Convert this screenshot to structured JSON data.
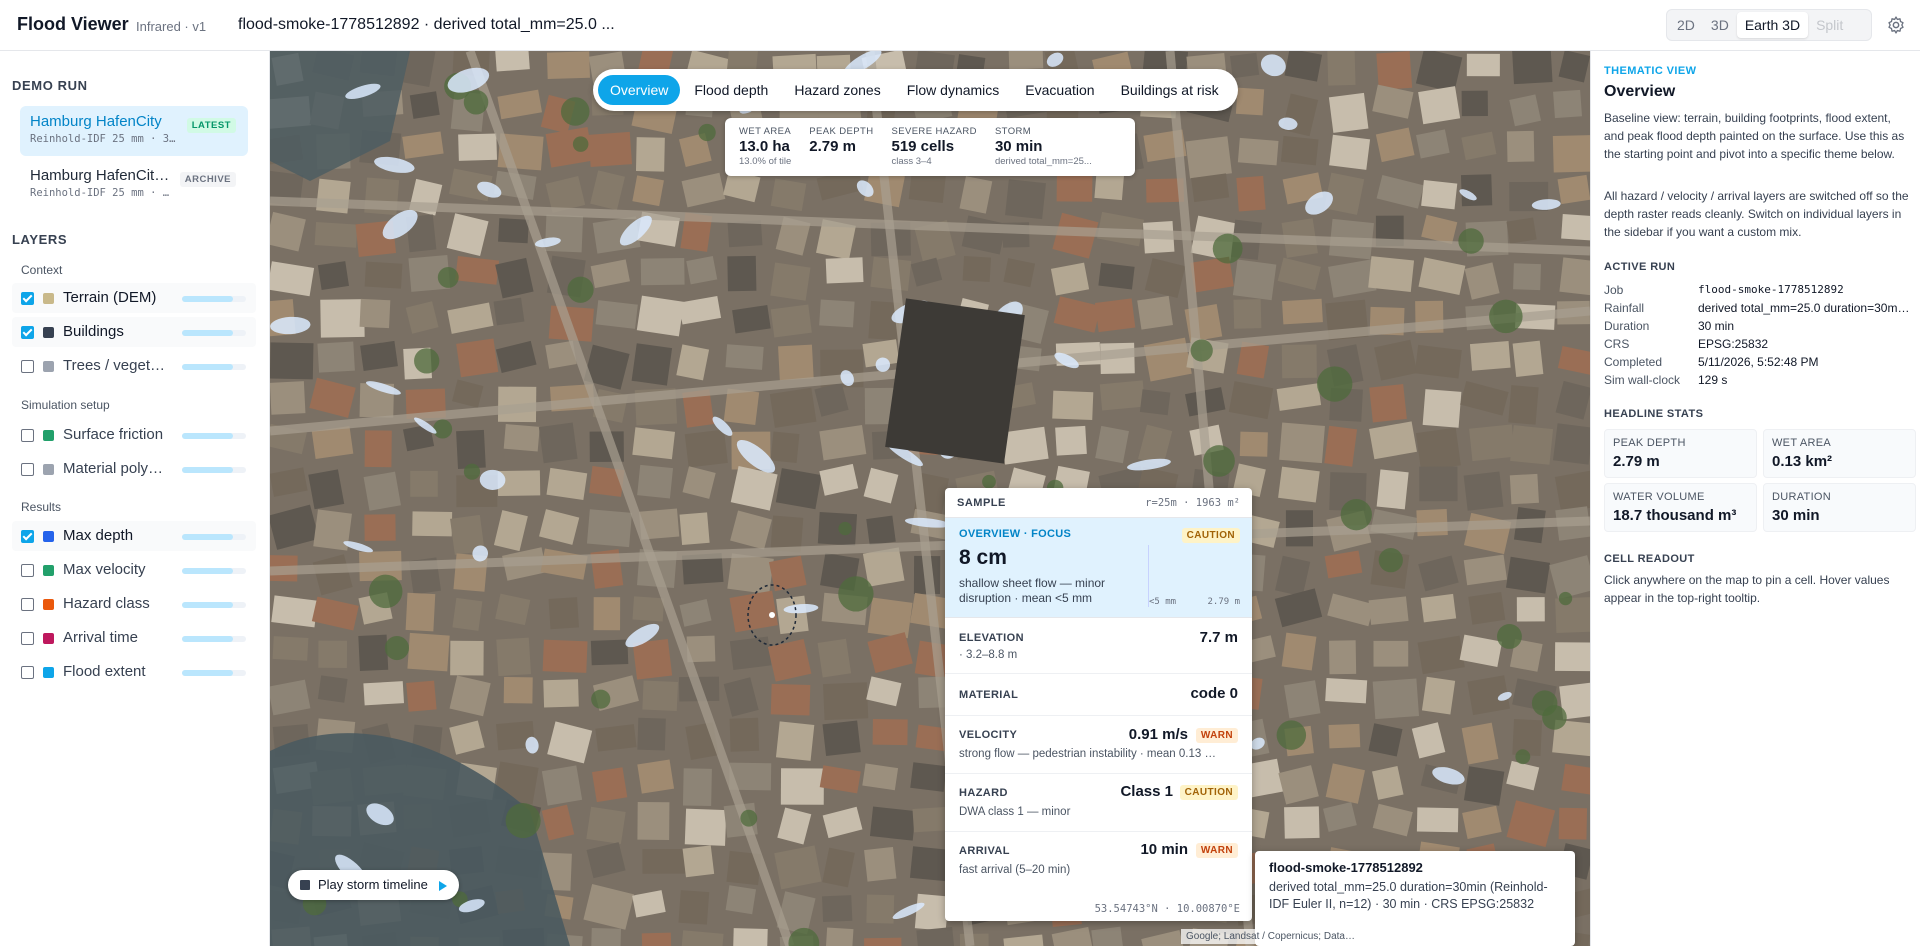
{
  "app": {
    "title": "Flood Viewer",
    "subtitle": "Infrared · v1",
    "job_title": "flood-smoke-1778512892 · derived total_mm=25.0 ..."
  },
  "view_modes": [
    {
      "label": "2D",
      "active": false
    },
    {
      "label": "3D",
      "active": false
    },
    {
      "label": "Earth 3D",
      "active": true
    },
    {
      "label": "Split",
      "active": false,
      "disabled": true
    }
  ],
  "sidebar": {
    "demo_run_heading": "DEMO RUN",
    "runs": [
      {
        "name": "Hamburg HafenCity",
        "meta": "Reinhold-IDF 25 mm · 3…",
        "badge": "LATEST",
        "active": true
      },
      {
        "name": "Hamburg HafenCit…",
        "meta": "Reinhold-IDF 25 mm · …",
        "badge": "ARCHIVE",
        "active": false
      }
    ],
    "layers_heading": "LAYERS",
    "groups": [
      {
        "label": "Context"
      },
      {
        "label": "Simulation setup"
      },
      {
        "label": "Results"
      }
    ],
    "layers": [
      {
        "label": "Terrain (DEM)",
        "checked": true,
        "color": "#c9b98a",
        "opacity": 0.8
      },
      {
        "label": "Buildings",
        "checked": true,
        "color": "#374151",
        "opacity": 0.8
      },
      {
        "label": "Trees / veget…",
        "checked": false,
        "color": "#9ca3af",
        "opacity": 0.8
      },
      {
        "label": "Surface friction",
        "checked": false,
        "color": "#22a06b",
        "opacity": 0.8
      },
      {
        "label": "Material poly…",
        "checked": false,
        "color": "#9ca3af",
        "opacity": 0.8
      },
      {
        "label": "Max depth",
        "checked": true,
        "color": "#2563eb",
        "opacity": 0.8
      },
      {
        "label": "Max velocity",
        "checked": false,
        "color": "#22a06b",
        "opacity": 0.8
      },
      {
        "label": "Hazard class",
        "checked": false,
        "color": "#ea580c",
        "opacity": 0.8
      },
      {
        "label": "Arrival time",
        "checked": false,
        "color": "#be185d",
        "opacity": 0.8
      },
      {
        "label": "Flood extent",
        "checked": false,
        "color": "#0ea5e9",
        "opacity": 0.8
      }
    ]
  },
  "map": {
    "tabs": [
      {
        "label": "Overview",
        "active": true
      },
      {
        "label": "Flood depth",
        "active": false
      },
      {
        "label": "Hazard zones",
        "active": false
      },
      {
        "label": "Flow dynamics",
        "active": false
      },
      {
        "label": "Evacuation",
        "active": false
      },
      {
        "label": "Buildings at risk",
        "active": false
      }
    ],
    "stats": [
      {
        "label": "WET AREA",
        "value": "13.0 ha",
        "sub": "13.0% of tile"
      },
      {
        "label": "PEAK DEPTH",
        "value": "2.79 m",
        "sub": ""
      },
      {
        "label": "SEVERE HAZARD",
        "value": "519 cells",
        "sub": "class 3–4"
      },
      {
        "label": "STORM",
        "value": "30 min",
        "sub": "derived total_mm=25..."
      }
    ],
    "play_label": "Play storm timeline",
    "attribution": "Google; Landsat / Copernicus; Data…"
  },
  "sample": {
    "title": "SAMPLE",
    "meta": "r=25m · 1963 m²",
    "focus_label": "OVERVIEW · FOCUS",
    "focus_badge": "CAUTION",
    "focus_value": "8 cm",
    "focus_desc": "shallow sheet flow — minor disruption · mean <5 mm",
    "scale_lo": "<5 mm",
    "scale_hi": "2.79 m",
    "elevation": {
      "label": "ELEVATION",
      "value": "7.7 m",
      "sub": "· 3.2–8.8 m"
    },
    "material": {
      "label": "MATERIAL",
      "value": "code 0"
    },
    "velocity": {
      "label": "VELOCITY",
      "value": "0.91 m/s",
      "badge": "WARN",
      "sub": "strong flow — pedestrian instability · mean 0.13 …"
    },
    "hazard": {
      "label": "HAZARD",
      "value": "Class 1",
      "badge": "CAUTION",
      "sub": "DWA class 1 — minor"
    },
    "arrival": {
      "label": "ARRIVAL",
      "value": "10 min",
      "badge": "WARN",
      "sub": "fast arrival (5–20 min)"
    },
    "coords": "53.54743°N · 10.00870°E"
  },
  "run_tooltip": {
    "title": "flood-smoke-1778512892",
    "body": "derived total_mm=25.0 duration=30min (Reinhold-IDF Euler II, n=12) · 30 min · CRS EPSG:25832"
  },
  "right_panel": {
    "eyebrow": "THEMATIC VIEW",
    "title": "Overview",
    "para1": "Baseline view: terrain, building footprints, flood extent, and peak flood depth painted on the surface. Use this as the starting point and pivot into a specific theme below.",
    "para2": "All hazard / velocity / arrival layers are switched off so the depth raster reads cleanly. Switch on individual layers in the sidebar if you want a custom mix.",
    "active_run_heading": "ACTIVE RUN",
    "active_run": [
      {
        "key": "Job",
        "value": "flood-smoke-1778512892",
        "mono": true
      },
      {
        "key": "Rainfall",
        "value": "derived total_mm=25.0 duration=30m…",
        "mono": false
      },
      {
        "key": "Duration",
        "value": "30 min",
        "mono": false
      },
      {
        "key": "CRS",
        "value": "EPSG:25832",
        "mono": false
      },
      {
        "key": "Completed",
        "value": "5/11/2026, 5:52:48 PM",
        "mono": false
      },
      {
        "key": "Sim wall-clock",
        "value": "129 s",
        "mono": false
      }
    ],
    "headline_heading": "HEADLINE STATS",
    "headline": [
      {
        "label": "PEAK DEPTH",
        "value": "2.79 m"
      },
      {
        "label": "WET AREA",
        "value": "0.13 km²"
      },
      {
        "label": "WATER VOLUME",
        "value": "18.7 thousand m³"
      },
      {
        "label": "DURATION",
        "value": "30 min"
      }
    ],
    "cell_heading": "CELL READOUT",
    "cell_text": "Click anywhere on the map to pin a cell. Hover values appear in the top-right tooltip."
  }
}
